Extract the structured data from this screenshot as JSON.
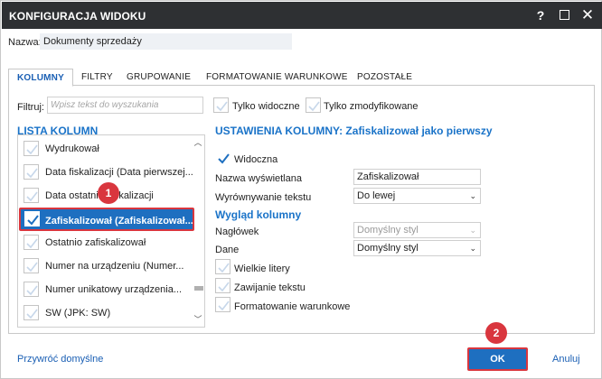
{
  "window": {
    "title": "KONFIGURACJA WIDOKU",
    "help_label": "?",
    "close_label": "✕"
  },
  "name_row": {
    "label": "Nazwa:",
    "value": "Dokumenty sprzedaży"
  },
  "tabs": [
    {
      "label": "KOLUMNY",
      "active": true
    },
    {
      "label": "FILTRY",
      "active": false
    },
    {
      "label": "GRUPOWANIE",
      "active": false
    },
    {
      "label": "FORMATOWANIE WARUNKOWE",
      "active": false
    },
    {
      "label": "POZOSTAŁE",
      "active": false
    }
  ],
  "filter": {
    "label": "Filtruj:",
    "placeholder": "Wpisz tekst do wyszukania",
    "only_visible_label": "Tylko widoczne",
    "only_visible_checked": false,
    "only_modified_label": "Tylko zmodyfikowane",
    "only_modified_checked": false
  },
  "column_list": {
    "title": "LISTA KOLUMN",
    "items": [
      {
        "label": "Wydrukował",
        "checked": false,
        "selected": false
      },
      {
        "label": "Data fiskalizacji (Data pierwszej...",
        "checked": false,
        "selected": false
      },
      {
        "label": "Data ostatniej fiskalizacji",
        "checked": false,
        "selected": false
      },
      {
        "label": "Zafiskalizował (Zafiskalizował...",
        "checked": true,
        "selected": true
      },
      {
        "label": "Ostatnio zafiskalizował",
        "checked": false,
        "selected": false
      },
      {
        "label": "Numer na urządzeniu (Numer...",
        "checked": false,
        "selected": false
      },
      {
        "label": "Numer unikatowy urządzenia...",
        "checked": false,
        "selected": false
      },
      {
        "label": "SW (JPK: SW)",
        "checked": false,
        "selected": false
      }
    ]
  },
  "settings": {
    "title": "USTAWIENIA KOLUMNY: Zafiskalizował jako pierwszy",
    "visible_label": "Widoczna",
    "visible_checked": true,
    "display_name_label": "Nazwa wyświetlana",
    "display_name_value": "Zafiskalizował",
    "text_align_label": "Wyrównywanie tekstu",
    "text_align_value": "Do lewej",
    "appearance_title": "Wygląd kolumny",
    "header_label": "Nagłówek",
    "header_value": "Domyślny styl",
    "data_label": "Dane",
    "data_value": "Domyślny styl",
    "uppercase_label": "Wielkie litery",
    "uppercase_checked": false,
    "wrap_label": "Zawijanie tekstu",
    "wrap_checked": false,
    "conditional_label": "Formatowanie warunkowe",
    "conditional_checked": false
  },
  "badges": {
    "step1": "1",
    "step2": "2"
  },
  "footer": {
    "reset_label": "Przywróć domyślne",
    "ok_label": "OK",
    "cancel_label": "Anuluj"
  },
  "colors": {
    "titlebar": "#2e3033",
    "accent": "#1e6fc0",
    "highlight_border": "#d9363e",
    "link": "#1a5fb4"
  }
}
